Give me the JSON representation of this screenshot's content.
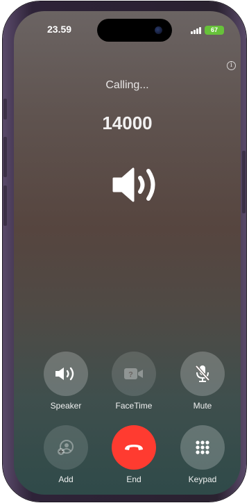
{
  "status_bar": {
    "time": "23.59",
    "battery": "67"
  },
  "call": {
    "status": "Calling...",
    "number": "14000"
  },
  "controls": {
    "speaker": "Speaker",
    "facetime": "FaceTime",
    "mute": "Mute",
    "add": "Add",
    "end": "End",
    "keypad": "Keypad"
  },
  "colors": {
    "end_button": "#ff3b30",
    "battery": "#67c23a"
  },
  "icons": {
    "info": "info-icon",
    "audio_route": "speaker-icon",
    "speaker": "speaker-icon",
    "facetime": "facetime-video-icon",
    "mute": "mic-slash-icon",
    "add": "add-person-icon",
    "end": "phone-down-icon",
    "keypad": "keypad-icon"
  }
}
